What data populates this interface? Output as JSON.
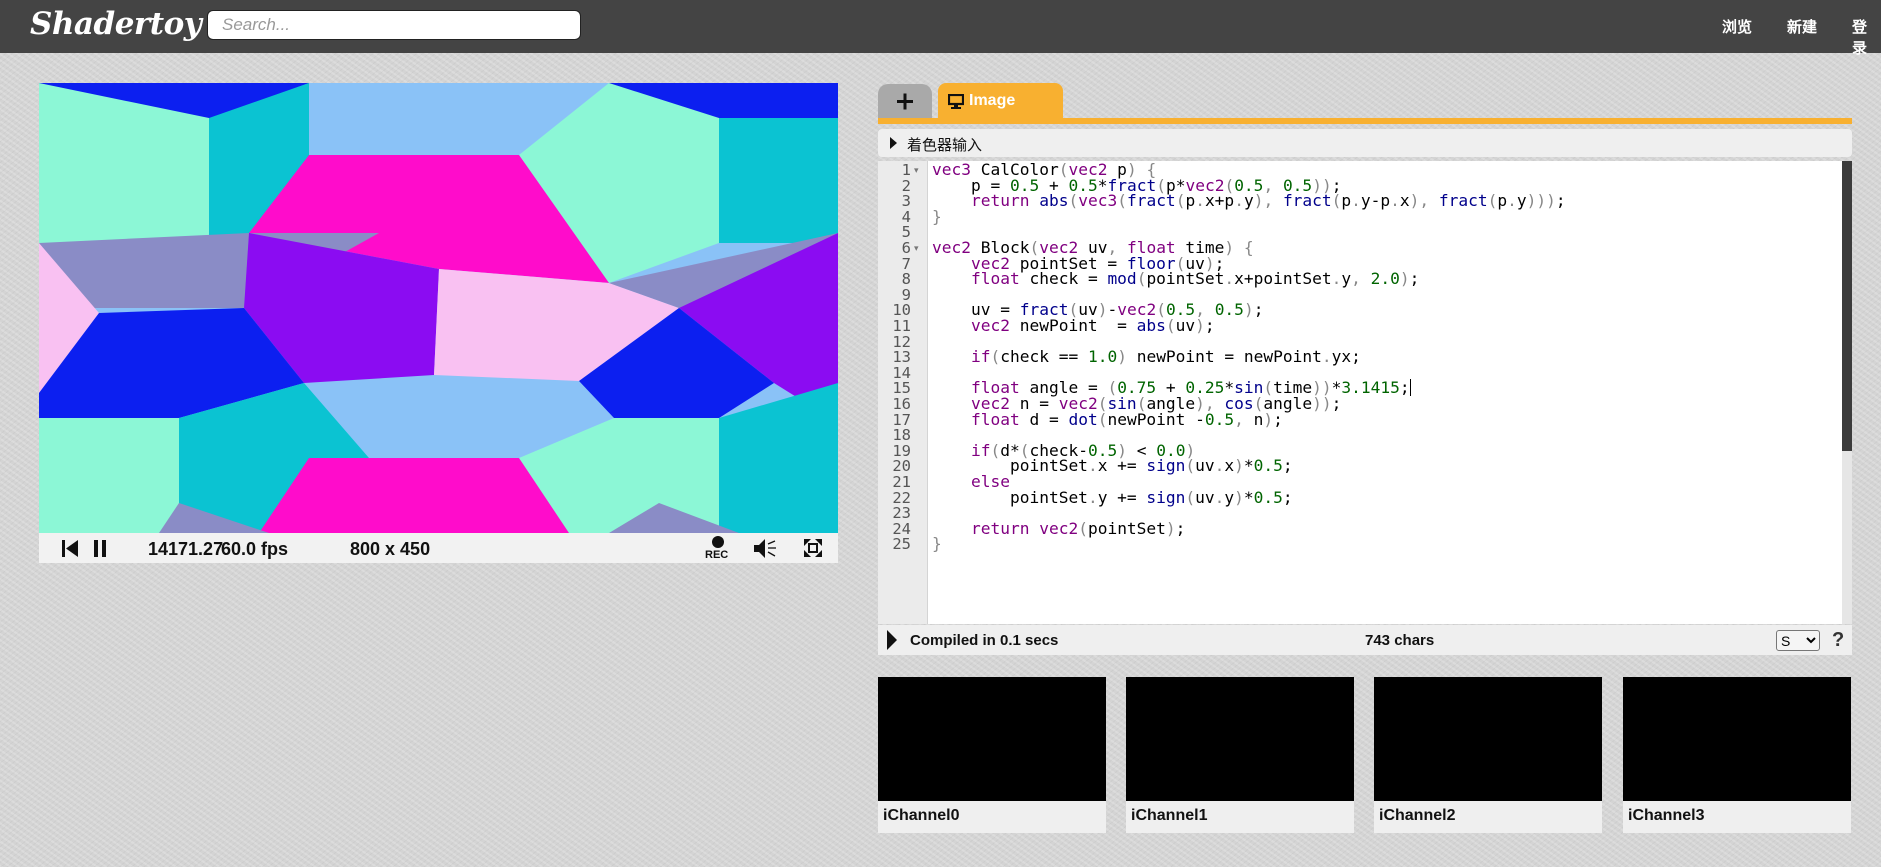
{
  "header": {
    "logo": "Shadertoy",
    "search_placeholder": "Search...",
    "nav": [
      "浏览",
      "新建",
      "登录"
    ]
  },
  "player": {
    "time": "14171.27",
    "fps": "60.0 fps",
    "resolution": "800 x 450",
    "rec_label": "REC",
    "colors": {
      "light_blue": "#8ac2f7",
      "blue": "#0c1ff0",
      "mint": "#8cf7d6",
      "teal": "#0bc3d2",
      "magenta": "#ff0ccb",
      "slate_purple": "#8a8cc6",
      "violet": "#8b0cf2",
      "pink": "#f9c1f2"
    }
  },
  "editor": {
    "tab_image_label": "Image",
    "shader_inputs_label": "着色器输入",
    "status": "Compiled in 0.1 secs",
    "char_count": "743 chars",
    "mode_option": "S",
    "help": "?",
    "code_lines": [
      "vec3 CalColor(vec2 p) {",
      "    p = 0.5 + 0.5*fract(p*vec2(0.5, 0.5));",
      "    return abs(vec3(fract(p.x+p.y), fract(p.y-p.x), fract(p.y)));",
      "}",
      "",
      "vec2 Block(vec2 uv, float time) {",
      "    vec2 pointSet = floor(uv);",
      "    float check = mod(pointSet.x+pointSet.y, 2.0);",
      "",
      "    uv = fract(uv)-vec2(0.5, 0.5);",
      "    vec2 newPoint  = abs(uv);",
      "",
      "    if(check == 1.0) newPoint = newPoint.yx;",
      "",
      "    float angle = (0.75 + 0.25*sin(time))*3.1415;",
      "    vec2 n = vec2(sin(angle), cos(angle));",
      "    float d = dot(newPoint -0.5, n);",
      "",
      "    if(d*(check-0.5) < 0.0)",
      "        pointSet.x += sign(uv.x)*0.5;",
      "    else",
      "        pointSet.y += sign(uv.y)*0.5;",
      "",
      "    return vec2(pointSet);",
      "}"
    ]
  },
  "channels": [
    "iChannel0",
    "iChannel1",
    "iChannel2",
    "iChannel3"
  ]
}
